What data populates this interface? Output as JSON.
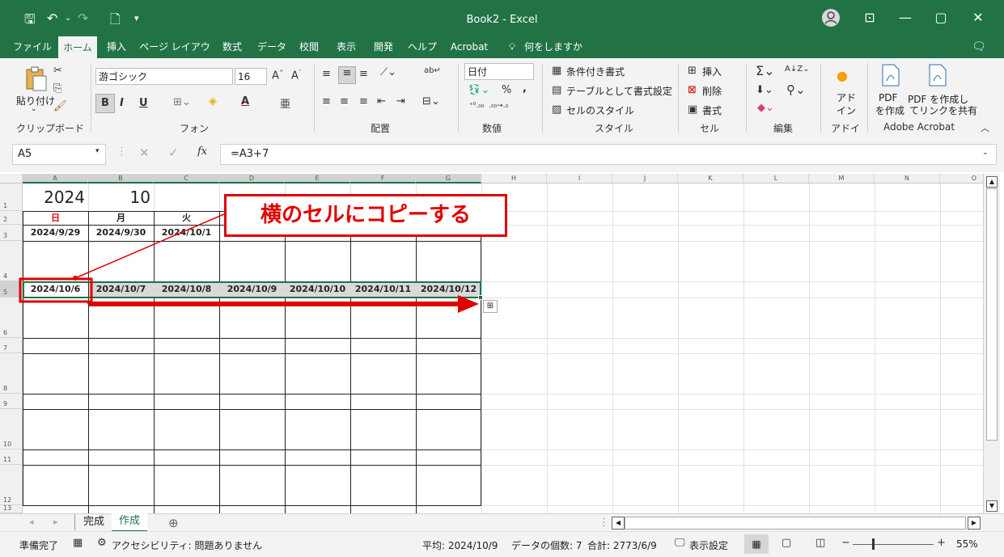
{
  "window": {
    "title": "Book2  -  Excel"
  },
  "tabs": [
    "ファイル",
    "ホーム",
    "挿入",
    "ページ レイアウト",
    "数式",
    "データ",
    "校閲",
    "表示",
    "開発",
    "ヘルプ",
    "Acrobat",
    "何をしますか"
  ],
  "ribbon": {
    "clipboard": {
      "paste_label": "貼り付け",
      "group": "クリップボード"
    },
    "font": {
      "name": "游ゴシック",
      "size": "16",
      "bold": "B",
      "italic": "I",
      "underline": "U",
      "group": "フォント"
    },
    "alignment": {
      "group": "配置"
    },
    "number": {
      "format": "日付",
      "percent": "%",
      "comma": ",",
      "group": "数値"
    },
    "styles": {
      "conditional": "条件付き書式",
      "table": "テーブルとして書式設定",
      "cell_style": "セルのスタイル",
      "group": "スタイル"
    },
    "cells": {
      "insert": "挿入",
      "delete": "削除",
      "format": "書式",
      "group": "セル"
    },
    "editing": {
      "group": "編集"
    },
    "addins": {
      "label_line1": "アド",
      "label_line2": "イン",
      "group": "アドイン"
    },
    "acrobat": {
      "pdf_create_1": "PDF",
      "pdf_create_2": "を作成",
      "pdf_share_1": "PDF を作成し",
      "pdf_share_2": "てリンクを共有",
      "group": "Adobe Acrobat"
    }
  },
  "formula_bar": {
    "name_box": "A5",
    "fx": "fx",
    "formula": "=A3+7"
  },
  "columns": [
    "A",
    "B",
    "C",
    "D",
    "E",
    "F",
    "G",
    "H",
    "I",
    "J",
    "K",
    "L",
    "M",
    "N",
    "O"
  ],
  "rows": [
    "1",
    "2",
    "3",
    "4",
    "5",
    "6",
    "7",
    "8",
    "9",
    "10",
    "11",
    "12",
    "13"
  ],
  "cells": {
    "a1": "2024",
    "b1": "10",
    "headers": [
      "日",
      "月",
      "火"
    ],
    "row3": [
      "2024/9/29",
      "2024/9/30",
      "2024/10/1"
    ],
    "row5": [
      "2024/10/6",
      "2024/10/7",
      "2024/10/8",
      "2024/10/9",
      "2024/10/10",
      "2024/10/11",
      "2024/10/12"
    ]
  },
  "annotation": {
    "text": "横のセルにコピーする",
    "color": "#e00000"
  },
  "sheets": [
    {
      "name": "完成",
      "active": false
    },
    {
      "name": "作成",
      "active": true
    }
  ],
  "status": {
    "ready": "準備完了",
    "accessibility": "アクセシビリティ: 問題ありません",
    "average": "平均: 2024/10/9",
    "count": "データの個数: 7",
    "sum": "合計: 2773/6/9",
    "display_settings": "表示設定",
    "zoom": "55%"
  },
  "colors": {
    "excel_green": "#217346",
    "selection_fill": "#d9d9d9"
  }
}
